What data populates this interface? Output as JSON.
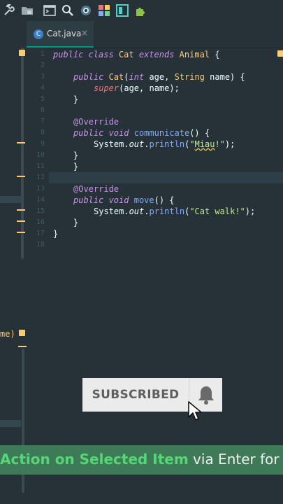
{
  "toolbar": {
    "icons": [
      "wrench-icon",
      "folder-icon",
      "terminal-icon",
      "search-icon",
      "circle-icon",
      "palette-icon",
      "layout-icon",
      "plugin-icon"
    ]
  },
  "tab": {
    "label": "Cat.java",
    "type_letter": "C",
    "close": "×"
  },
  "gutter": {
    "line_numbers": [
      "1",
      "2",
      "3",
      "4",
      "5",
      "6",
      "7",
      "8",
      "9",
      "10",
      "11",
      "12",
      "13",
      "14",
      "15",
      "16",
      "17",
      "18"
    ]
  },
  "code": {
    "l1": {
      "kw": "public class",
      "name": "Cat",
      "kw2": "extends",
      "parent": "Animal",
      "brace": " {"
    },
    "l3": {
      "kw": "public",
      "name": "Cat",
      "open": "(",
      "t1": "int",
      "p1": " age, ",
      "t2": "String",
      "p2": " name) {"
    },
    "l4": {
      "kw": "super",
      "rest": "(age, name);"
    },
    "l5": {
      "text": "}"
    },
    "l7": {
      "ann": "@Override"
    },
    "l8": {
      "kw": "public void",
      "fn": "communicate",
      "rest": "() {"
    },
    "l9": {
      "obj": "System.",
      "fld": "out",
      "dot": ".",
      "fn": "println",
      "open": "(",
      "str1": "\"",
      "warn": "Miau",
      "str2": "!\"",
      "close": ");"
    },
    "l10": {
      "text": "}"
    },
    "l11": {
      "text": "}"
    },
    "l13": {
      "ann": "@Override"
    },
    "l14": {
      "kw": "public void",
      "fn": "move",
      "rest": "() {"
    },
    "l15": {
      "obj": "System.",
      "fld": "out",
      "dot": ".",
      "fn": "println",
      "open": "(",
      "str": "\"Cat walk!\"",
      "close": ");"
    },
    "l16": {
      "text": "}"
    },
    "l17": {
      "text": "}"
    }
  },
  "left_panel": {
    "cut_text": "me)"
  },
  "subscribe": {
    "label": "SUBSCRIBED"
  },
  "banner": {
    "highlight": "Action on Selected Item",
    "rest": " via Enter for"
  },
  "colors": {
    "background": "#263238",
    "accent": "#009688",
    "keyword": "#c792ea",
    "string": "#c3e88d",
    "function": "#82aaff",
    "class": "#ffcb6b",
    "banner": "#3e7a58"
  }
}
